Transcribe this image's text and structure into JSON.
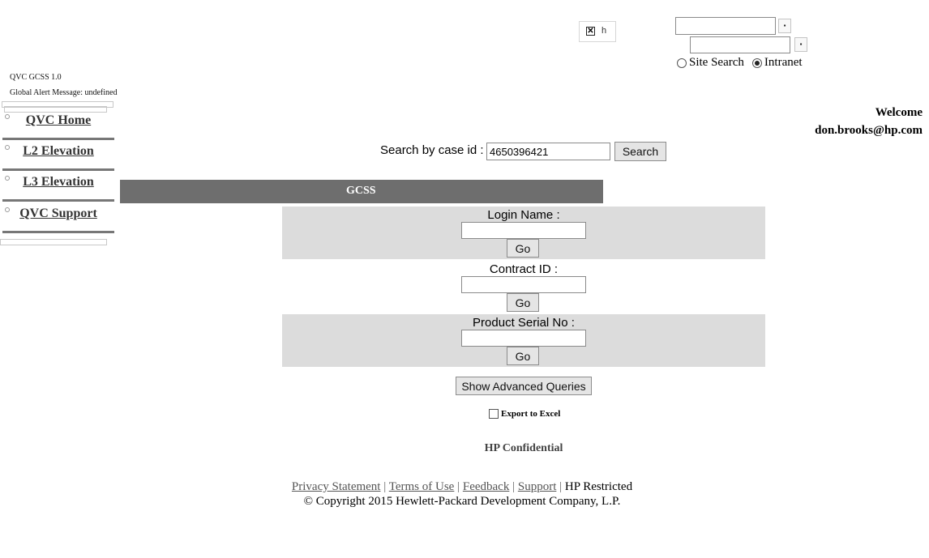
{
  "header": {
    "broken_image_alt": "h",
    "search_scope": {
      "options": [
        "Site Search",
        "Intranet"
      ],
      "selected": "Intranet"
    }
  },
  "app_info": {
    "version": "QVC GCSS 1.0",
    "alert": "Global Alert Message: undefined"
  },
  "nav": {
    "items": [
      {
        "label": "QVC Home"
      },
      {
        "label": "L2 Elevation"
      },
      {
        "label": "L3 Elevation"
      },
      {
        "label": "QVC Support"
      }
    ]
  },
  "user": {
    "welcome": "Welcome",
    "email": "don.brooks@hp.com"
  },
  "case_search": {
    "label": "Search by case id :",
    "value": "4650396421",
    "button": "Search"
  },
  "section_title": "GCSS",
  "queries": [
    {
      "label": "Login Name :",
      "value": "",
      "button": "Go"
    },
    {
      "label": "Contract ID :",
      "value": "",
      "button": "Go"
    },
    {
      "label": "Product Serial No :",
      "value": "",
      "button": "Go"
    }
  ],
  "advanced_button": "Show Advanced Queries",
  "export": {
    "label": "Export to Excel",
    "checked": false
  },
  "confidential": "HP Confidential",
  "footer": {
    "links": [
      "Privacy Statement",
      "Terms of Use",
      "Feedback",
      "Support"
    ],
    "restricted": "HP Restricted",
    "copyright": "© Copyright 2015 Hewlett-Packard Development Company, L.P."
  }
}
